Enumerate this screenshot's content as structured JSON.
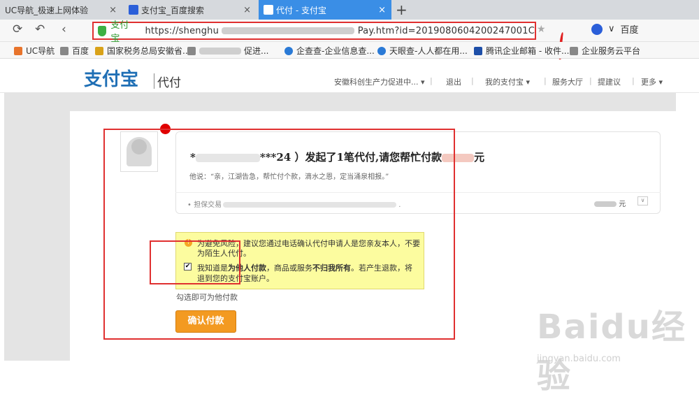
{
  "tabs": [
    {
      "label": "UC导航_极速上网体验",
      "close": "×"
    },
    {
      "label": "支付宝_百度搜索",
      "close": "×"
    },
    {
      "label": "代付 - 支付宝",
      "close": "×"
    }
  ],
  "new_tab": "+",
  "address": {
    "site_label": "支付宝",
    "url_start": "https://shenghu",
    "url_end": "Pay.htm?id=2019080604200247001C"
  },
  "search_engine": "百度",
  "bookmarks": [
    {
      "label": "UC导航",
      "color": "#e8742c"
    },
    {
      "label": "百度",
      "color": "#888"
    },
    {
      "label": "国家税务总局安徽省...",
      "color": "#d9a219"
    },
    {
      "label": "促进...",
      "color": "#888"
    },
    {
      "label": "企查查-企业信息查...",
      "color": "#2a7ad6"
    },
    {
      "label": "天眼查-人人都在用...",
      "color": "#2a7ad6"
    },
    {
      "label": "腾讯企业邮箱 - 收件...",
      "color": "#1e4fa8"
    },
    {
      "label": "企业服务云平台",
      "color": "#888"
    }
  ],
  "header": {
    "logo": "支付宝",
    "sub": "代付",
    "nav": [
      "安徽科创生产力促进中...",
      "退出",
      "我的支付宝",
      "服务大厅",
      "提建议",
      "更多"
    ]
  },
  "card": {
    "title_prefix": "*",
    "title_mid": "***24 ）发起了",
    "count": "1",
    "title_suffix": "笔代付,请您帮忙付款",
    "unit": "元",
    "message": "他说：“亲，江湖告急，帮忙付个款，滴水之恩，定当涌泉相报。”",
    "trade_label": "• 担保交易",
    "amount_unit": "元",
    "dropdown": "∨"
  },
  "notice": {
    "line1": "为避免风险，建议您通过电话确认代付申请人是您亲友本人，不要",
    "line2": "为陌生人代付。",
    "check_a": "我知道是",
    "check_b": "为他人付款",
    "check_c": "，商品或服务",
    "check_d": "不归我所有",
    "check_e": "。若产生退款，将",
    "check_line2": "退到您的支付宝账户。",
    "checkbox": "✔"
  },
  "hint": "勾选即可为他付款",
  "confirm_label": "确认付款",
  "watermark": {
    "main": "Baidu经验",
    "sub": "jingyan.baidu.com"
  }
}
